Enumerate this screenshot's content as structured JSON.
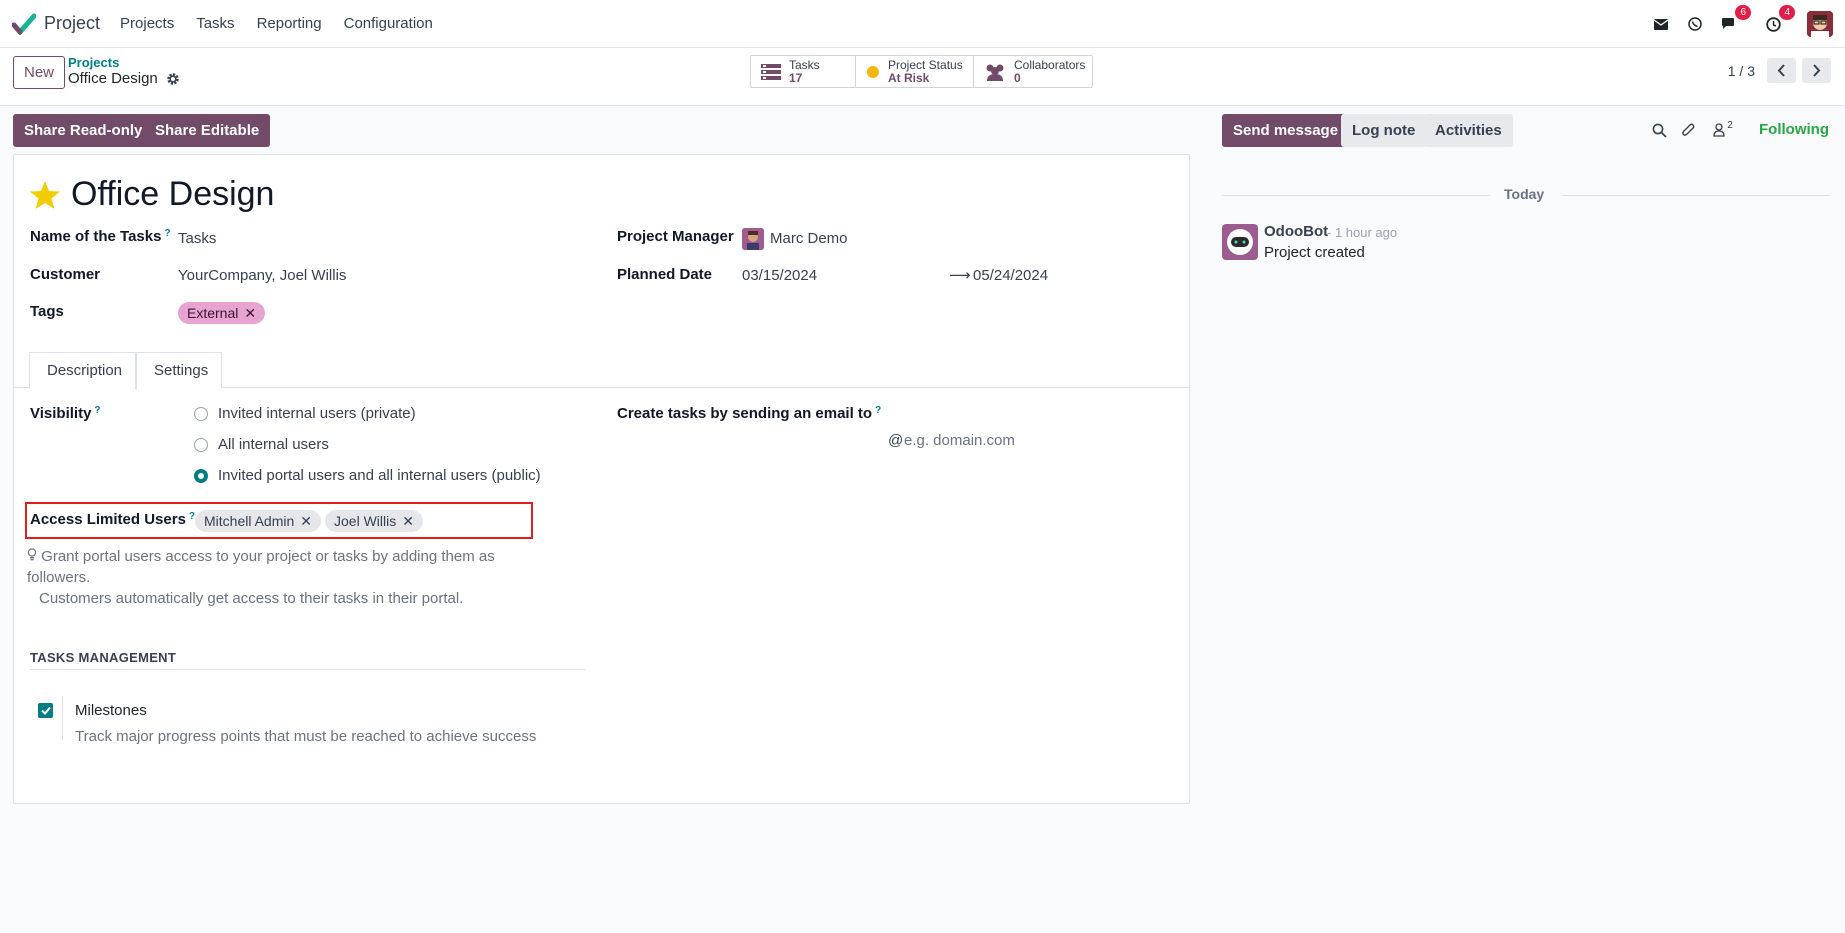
{
  "navbar": {
    "app_name": "Project",
    "menu": [
      "Projects",
      "Tasks",
      "Reporting",
      "Configuration"
    ],
    "badges": {
      "messages": "6",
      "activities": "4"
    }
  },
  "control": {
    "new_label": "New",
    "breadcrumb_parent": "Projects",
    "breadcrumb_current": "Office Design",
    "stats": [
      {
        "label": "Tasks",
        "value": "17",
        "icon": "tasks-icon"
      },
      {
        "label": "Project Status",
        "value": "At Risk",
        "icon": "status-dot-icon",
        "color": "#f3b60c"
      },
      {
        "label": "Collaborators",
        "value": "0",
        "icon": "users-icon"
      }
    ],
    "pager": "1 / 3"
  },
  "actions": {
    "share_readonly": "Share Read-only",
    "share_editable": "Share Editable"
  },
  "form": {
    "title": "Office Design",
    "name_of_tasks_label": "Name of the Tasks",
    "name_of_tasks_value": "Tasks",
    "customer_label": "Customer",
    "customer_value": "YourCompany, Joel Willis",
    "tags_label": "Tags",
    "tags": [
      "External"
    ],
    "project_manager_label": "Project Manager",
    "project_manager_value": "Marc Demo",
    "planned_date_label": "Planned Date",
    "planned_date_start": "03/15/2024",
    "planned_date_end": "05/24/2024",
    "tabs": [
      "Description",
      "Settings"
    ],
    "visibility_label": "Visibility",
    "visibility_options": [
      {
        "label": "Invited internal users (private)",
        "checked": false
      },
      {
        "label": "All internal users",
        "checked": false
      },
      {
        "label": "Invited portal users and all internal users (public)",
        "checked": true
      }
    ],
    "access_limited_label": "Access Limited Users",
    "access_limited_users": [
      "Mitchell Admin",
      "Joel Willis"
    ],
    "hint_line1": "Grant portal users access to your project or tasks by adding them as followers.",
    "hint_line2": "Customers automatically get access to their tasks in their portal.",
    "email_label": "Create tasks by sending an email to",
    "email_placeholder": "e.g. domain.com",
    "section_title": "TASKS MANAGEMENT",
    "milestones_label": "Milestones",
    "milestones_desc": "Track major progress points that must be reached to achieve success",
    "milestones_checked": true,
    "help_mark": "?"
  },
  "chatter": {
    "send_message": "Send message",
    "log_note": "Log note",
    "activities": "Activities",
    "followers_count": "2",
    "following": "Following",
    "today": "Today",
    "messages": [
      {
        "author": "OdooBot",
        "time": "- 1 hour ago",
        "body": "Project created"
      }
    ]
  }
}
